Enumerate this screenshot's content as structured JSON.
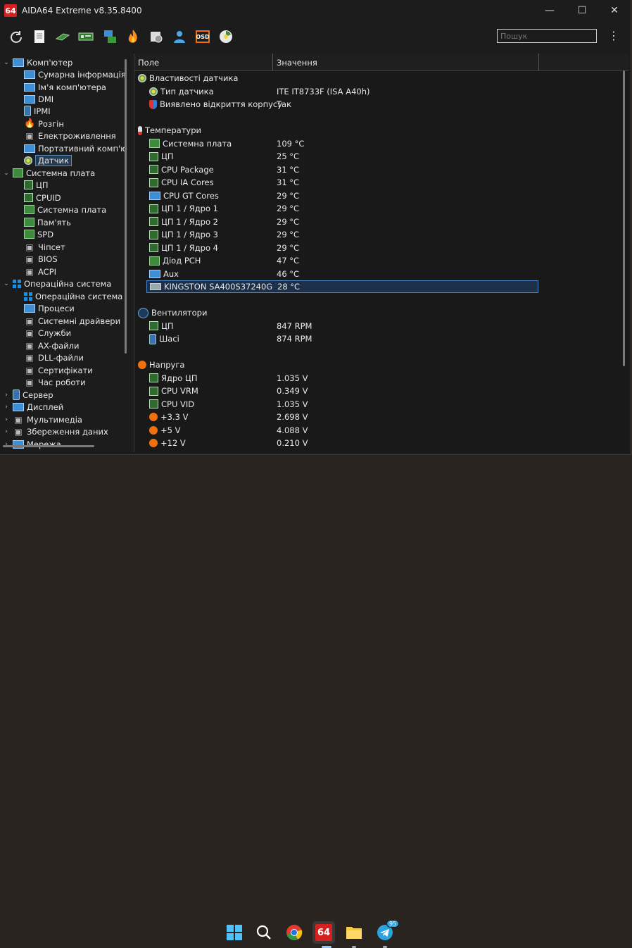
{
  "window": {
    "app_logo": "64",
    "title": "AIDA64 Extreme v8.35.8400",
    "controls": {
      "minimize": "—",
      "maximize": "☐",
      "close": "✕"
    }
  },
  "toolbar": {
    "buttons": [
      "refresh-icon",
      "report-icon",
      "memory-module-icon",
      "motherboard-icon",
      "network-icon",
      "flame-icon",
      "tools-icon",
      "user-icon",
      "osd-icon",
      "sensor-icon"
    ],
    "osd_label": "OSD",
    "search_placeholder": "Пошук",
    "menu_glyph": "⋮"
  },
  "sidebar": {
    "items": [
      {
        "label": "Комп'ютер",
        "level": 0,
        "chev": "⌄",
        "icon": "monitor"
      },
      {
        "label": "Сумарна інформація",
        "level": 1,
        "icon": "monitor"
      },
      {
        "label": "Ім'я комп'ютера",
        "level": 1,
        "icon": "monitor"
      },
      {
        "label": "DMI",
        "level": 1,
        "icon": "monitor"
      },
      {
        "label": "IPMI",
        "level": 1,
        "icon": "phone"
      },
      {
        "label": "Розгін",
        "level": 1,
        "icon": "flame"
      },
      {
        "label": "Електроживлення",
        "level": 1,
        "icon": "gen"
      },
      {
        "label": "Портативний комп'ю",
        "level": 1,
        "icon": "monitor"
      },
      {
        "label": "Датчик",
        "level": 1,
        "icon": "round",
        "selected": true
      },
      {
        "label": "Системна плата",
        "level": 0,
        "chev": "⌄",
        "icon": "board"
      },
      {
        "label": "ЦП",
        "level": 1,
        "icon": "chip"
      },
      {
        "label": "CPUID",
        "level": 1,
        "icon": "chip"
      },
      {
        "label": "Системна плата",
        "level": 1,
        "icon": "board"
      },
      {
        "label": "Пам'ять",
        "level": 1,
        "icon": "board"
      },
      {
        "label": "SPD",
        "level": 1,
        "icon": "board"
      },
      {
        "label": "Чіпсет",
        "level": 1,
        "icon": "gen"
      },
      {
        "label": "BIOS",
        "level": 1,
        "icon": "gen"
      },
      {
        "label": "ACPI",
        "level": 1,
        "icon": "gen"
      },
      {
        "label": "Операційна система",
        "level": 0,
        "chev": "⌄",
        "icon": "win"
      },
      {
        "label": "Операційна система",
        "level": 1,
        "icon": "win"
      },
      {
        "label": "Процеси",
        "level": 1,
        "icon": "monitor"
      },
      {
        "label": "Системні драйвери",
        "level": 1,
        "icon": "gen"
      },
      {
        "label": "Служби",
        "level": 1,
        "icon": "gen"
      },
      {
        "label": "AX-файли",
        "level": 1,
        "icon": "gen"
      },
      {
        "label": "DLL-файли",
        "level": 1,
        "icon": "gen"
      },
      {
        "label": "Сертифікати",
        "level": 1,
        "icon": "gen"
      },
      {
        "label": "Час роботи",
        "level": 1,
        "icon": "gen"
      },
      {
        "label": "Сервер",
        "level": 0,
        "chev": "›",
        "icon": "phone"
      },
      {
        "label": "Дисплей",
        "level": 0,
        "chev": "›",
        "icon": "monitor"
      },
      {
        "label": "Мультимедіа",
        "level": 0,
        "chev": "›",
        "icon": "gen"
      },
      {
        "label": "Збереження даних",
        "level": 0,
        "chev": "›",
        "icon": "gen"
      },
      {
        "label": "Мережа",
        "level": 0,
        "chev": "›",
        "icon": "monitor"
      }
    ]
  },
  "grid": {
    "columns": [
      "Поле",
      "Значення"
    ],
    "rows": [
      {
        "type": "group",
        "field": "Властивості датчика",
        "icon": "round"
      },
      {
        "type": "item",
        "field": "Тип датчика",
        "value": "ITE IT8733F  (ISA A40h)",
        "icon": "round"
      },
      {
        "type": "item",
        "field": "Виявлено відкриття корпусу",
        "value": "Так",
        "icon": "shield"
      },
      {
        "type": "blank"
      },
      {
        "type": "group",
        "field": "Температури",
        "icon": "therm"
      },
      {
        "type": "item",
        "field": "Системна плата",
        "value": "109 °C",
        "icon": "board"
      },
      {
        "type": "item",
        "field": "ЦП",
        "value": "25 °C",
        "icon": "chip"
      },
      {
        "type": "item",
        "field": "CPU Package",
        "value": "31 °C",
        "icon": "chip"
      },
      {
        "type": "item",
        "field": "CPU IA Cores",
        "value": "31 °C",
        "icon": "chip"
      },
      {
        "type": "item",
        "field": "CPU GT Cores",
        "value": "29 °C",
        "icon": "monitor"
      },
      {
        "type": "item",
        "field": "ЦП 1 / Ядро 1",
        "value": "29 °C",
        "icon": "chip"
      },
      {
        "type": "item",
        "field": "ЦП 1 / Ядро 2",
        "value": "29 °C",
        "icon": "chip"
      },
      {
        "type": "item",
        "field": "ЦП 1 / Ядро 3",
        "value": "29 °C",
        "icon": "chip"
      },
      {
        "type": "item",
        "field": "ЦП 1 / Ядро 4",
        "value": "29 °C",
        "icon": "chip"
      },
      {
        "type": "item",
        "field": "Діод PCH",
        "value": "47 °C",
        "icon": "board"
      },
      {
        "type": "item",
        "field": "Aux",
        "value": "46 °C",
        "icon": "monitor"
      },
      {
        "type": "item",
        "field": "KINGSTON SA400S37240G",
        "value": "28 °C",
        "icon": "disk",
        "selected": true
      },
      {
        "type": "blank"
      },
      {
        "type": "group",
        "field": "Вентилятори",
        "icon": "fan"
      },
      {
        "type": "item",
        "field": "ЦП",
        "value": "847 RPM",
        "icon": "chip"
      },
      {
        "type": "item",
        "field": "Шасі",
        "value": "874 RPM",
        "icon": "phone"
      },
      {
        "type": "blank"
      },
      {
        "type": "group",
        "field": "Напруга",
        "icon": "bolt"
      },
      {
        "type": "item",
        "field": "Ядро ЦП",
        "value": "1.035 V",
        "icon": "chip"
      },
      {
        "type": "item",
        "field": "CPU VRM",
        "value": "0.349 V",
        "icon": "chip"
      },
      {
        "type": "item",
        "field": "CPU VID",
        "value": "1.035 V",
        "icon": "chip"
      },
      {
        "type": "item",
        "field": "+3.3 V",
        "value": "2.698 V",
        "icon": "bolt"
      },
      {
        "type": "item",
        "field": "+5 V",
        "value": "4.088 V",
        "icon": "bolt"
      },
      {
        "type": "item",
        "field": "+12 V",
        "value": "0.210 V",
        "icon": "bolt"
      }
    ]
  },
  "taskbar": {
    "apps": [
      {
        "name": "start-button"
      },
      {
        "name": "search-button"
      },
      {
        "name": "chrome-app"
      },
      {
        "name": "aida64-app",
        "label": "64"
      },
      {
        "name": "file-explorer-app"
      },
      {
        "name": "telegram-app",
        "badge": "95"
      }
    ]
  }
}
